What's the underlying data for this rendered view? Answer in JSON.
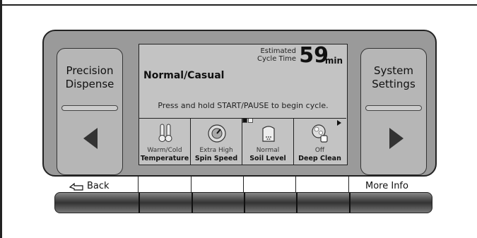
{
  "side_buttons": {
    "left_label_1": "Precision",
    "left_label_2": "Dispense",
    "right_label_1": "System",
    "right_label_2": "Settings",
    "left_arrow_icon": "chevron-left-icon",
    "right_arrow_icon": "chevron-right-icon"
  },
  "screen": {
    "estimated_label_1": "Estimated",
    "estimated_label_2": "Cycle Time",
    "time_value": "59",
    "time_unit": "min",
    "cycle_name": "Normal/Casual",
    "prompt": "Press and hold START/PAUSE to begin cycle.",
    "page_indicator": {
      "pages": 2,
      "active": 1
    },
    "options": [
      {
        "icon": "thermometer-icon",
        "value": "Warm/Cold",
        "name": "Temperature"
      },
      {
        "icon": "spin-gauge-icon",
        "value": "Extra High",
        "name": "Spin Speed"
      },
      {
        "icon": "shirt-icon",
        "value": "Normal",
        "name": "Soil Level"
      },
      {
        "icon": "deep-clean-icon",
        "value": "Off",
        "name": "Deep Clean"
      }
    ]
  },
  "softkeys": {
    "back_label": "Back",
    "back_icon": "back-arrow-icon",
    "more_info_label": "More Info"
  },
  "colors": {
    "panel": "#9a9a9a",
    "screen": "#c3c3c3",
    "button": "#b6b6b6"
  }
}
